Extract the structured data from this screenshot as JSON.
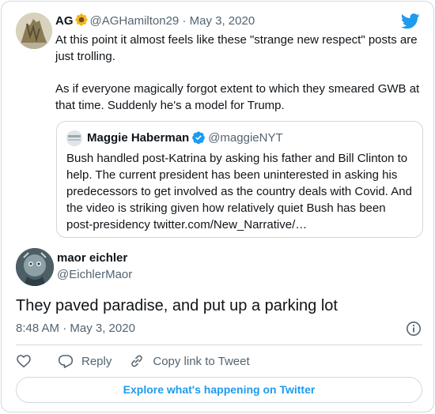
{
  "parent_tweet": {
    "author_name": "AG",
    "emoji": "sunflower-emoji",
    "handle": "@AGHamilton29",
    "separator": "·",
    "date": "May 3, 2020",
    "text_p1": "At this point it almost feels like these \"strange new respect\" posts are just trolling.",
    "text_p2": "As if everyone magically forgot extent to which they smeared GWB at that time. Suddenly he's a model for Trump."
  },
  "quoted_tweet": {
    "author_name": "Maggie Haberman",
    "verified": true,
    "handle": "@maggieNYT",
    "text": "Bush handled post-Katrina by asking his father and Bill Clinton to help. The current president has been uninterested in asking his predecessors to get involved as the country deals with Covid. And the video is striking given how relatively quiet Bush has been post-presidency twitter.com/New_Narrative/…"
  },
  "main_tweet": {
    "author_name": "maor eichler",
    "handle": "@EichlerMaor",
    "text": "They paved paradise, and put up a parking lot",
    "timestamp": "8:48 AM · May 3, 2020"
  },
  "actions": {
    "like_icon": "heart-icon",
    "reply_label": "Reply",
    "copy_link_label": "Copy link to Tweet"
  },
  "explore_label": "Explore what's happening on Twitter",
  "colors": {
    "accent": "#1d9bf0",
    "text": "#0f1419",
    "muted": "#536471",
    "border": "#cfd9de"
  }
}
